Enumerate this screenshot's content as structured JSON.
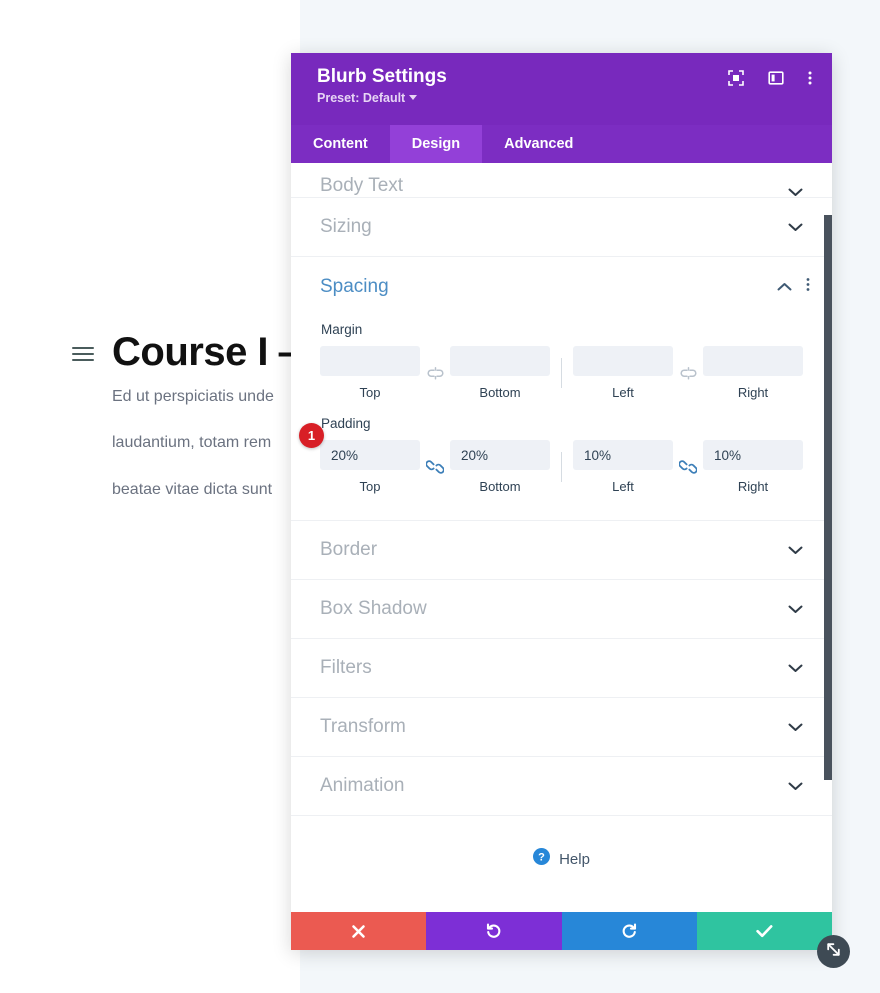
{
  "page": {
    "course_title": "Course I —",
    "hamburger_icon": "hamburger-menu-icon",
    "paragraphs": [
      "Ed ut perspiciatis unde",
      "laudantium, totam rem",
      "beatae vitae dicta sunt"
    ]
  },
  "modal": {
    "title": "Blurb Settings",
    "preset_label": "Preset: Default",
    "header_icons": [
      {
        "name": "focus-mode-icon"
      },
      {
        "name": "panel-layout-icon"
      },
      {
        "name": "kebab-menu-icon"
      }
    ],
    "tabs": [
      {
        "label": "Content",
        "active": false
      },
      {
        "label": "Design",
        "active": true
      },
      {
        "label": "Advanced",
        "active": false
      }
    ],
    "sections_above": [
      {
        "label": "Body Text",
        "expanded": false,
        "clipped": true
      },
      {
        "label": "Sizing",
        "expanded": false,
        "clipped": false
      }
    ],
    "spacing": {
      "label": "Spacing",
      "expanded": true,
      "collapse_icon": "chevron-up-icon",
      "options_icon": "kebab-menu-icon",
      "badge": "1",
      "margin": {
        "group_label": "Margin",
        "link_state": "unlinked",
        "fields": [
          {
            "sub": "Top",
            "value": "",
            "placeholder": ""
          },
          {
            "sub": "Bottom",
            "value": "",
            "placeholder": ""
          },
          {
            "sub": "Left",
            "value": "",
            "placeholder": ""
          },
          {
            "sub": "Right",
            "value": "",
            "placeholder": ""
          }
        ]
      },
      "padding": {
        "group_label": "Padding",
        "link_state": "linked",
        "fields": [
          {
            "sub": "Top",
            "value": "20%",
            "placeholder": ""
          },
          {
            "sub": "Bottom",
            "value": "20%",
            "placeholder": ""
          },
          {
            "sub": "Left",
            "value": "10%",
            "placeholder": ""
          },
          {
            "sub": "Right",
            "value": "10%",
            "placeholder": ""
          }
        ]
      }
    },
    "sections_below": [
      {
        "label": "Border",
        "expanded": false
      },
      {
        "label": "Box Shadow",
        "expanded": false
      },
      {
        "label": "Filters",
        "expanded": false
      },
      {
        "label": "Transform",
        "expanded": false
      },
      {
        "label": "Animation",
        "expanded": false
      }
    ],
    "help": {
      "label": "Help",
      "icon": "help-question-icon"
    },
    "footer_buttons": [
      {
        "name": "cancel-button",
        "icon": "close-x-icon"
      },
      {
        "name": "undo-button",
        "icon": "undo-arrow-icon"
      },
      {
        "name": "redo-button",
        "icon": "redo-arrow-icon"
      },
      {
        "name": "save-button",
        "icon": "checkmark-icon"
      }
    ],
    "resize_handle_icon": "resize-diagonal-icon"
  },
  "colors": {
    "header_purple": "#7829bd",
    "tab_purple": "#7c2dc2",
    "tab_active_purple": "#9340d8",
    "section_open_blue": "#4c8dc4",
    "badge_red": "#d81f26",
    "cancel_red": "#eb5a51",
    "undo_purple": "#7d2fd6",
    "redo_blue": "#2787d8",
    "save_teal": "#2fc4a0",
    "link_active_blue": "#3d7fb8"
  }
}
